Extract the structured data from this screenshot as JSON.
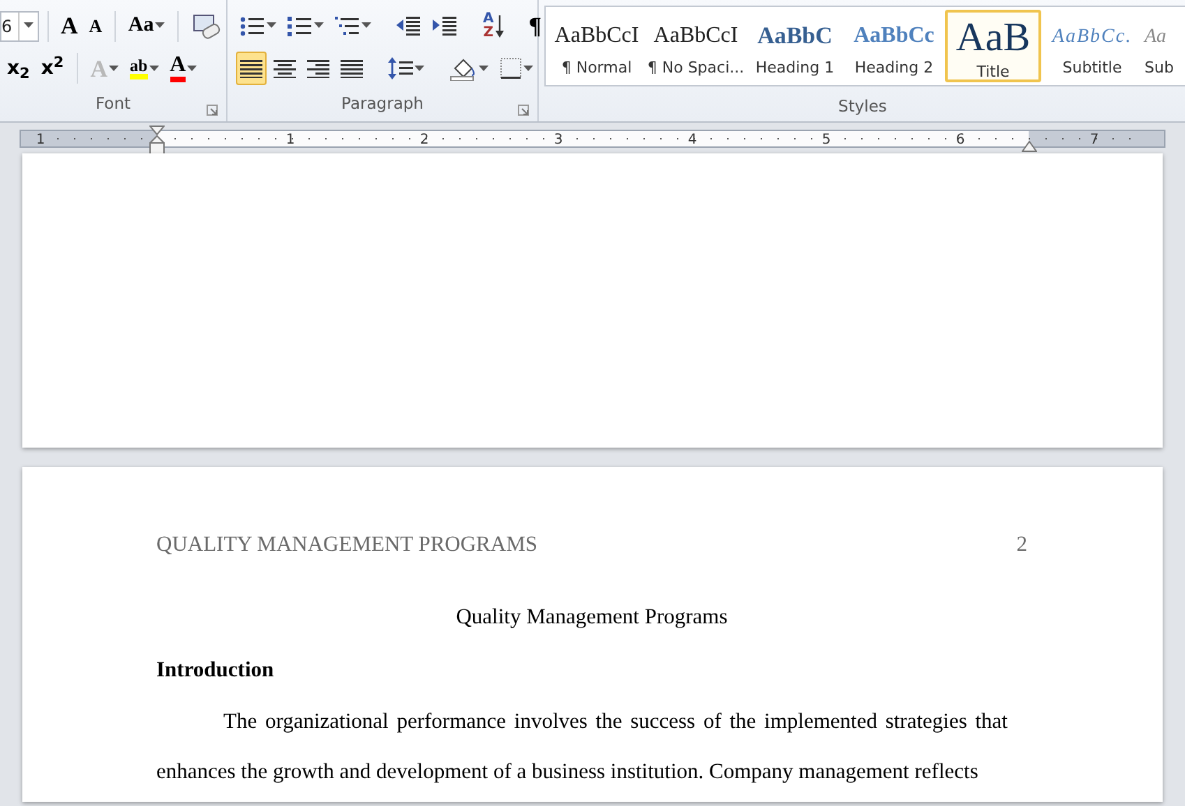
{
  "ribbon": {
    "font_group": {
      "font_size": "6",
      "label": "Font",
      "buttons_row_1": [
        {
          "kind": "grow",
          "glyph": "A"
        },
        {
          "kind": "shrink",
          "glyph": "A"
        },
        {
          "kind": "case",
          "glyph": "Aa"
        },
        {
          "kind": "clear"
        }
      ],
      "buttons_row_2": [
        {
          "kind": "subscript",
          "glyph": "x$_{2}$"
        },
        {
          "kind": "superscript",
          "glyph": "x$^{2}$"
        },
        {
          "kind": "effects",
          "glyph": "A",
          "disabled": true
        },
        {
          "kind": "highlight",
          "glyph": "ab",
          "color": "#ffff00"
        },
        {
          "kind": "fontcolor",
          "glyph": "A",
          "color": "#ff0000"
        }
      ]
    },
    "paragraph_group": {
      "label": "Paragraph",
      "buttons_row_1": [
        {
          "kind": "bullets"
        },
        {
          "kind": "numbering"
        },
        {
          "kind": "multilevel"
        },
        {
          "kind": "outdent"
        },
        {
          "kind": "indent"
        },
        {
          "kind": "sort",
          "glyph": "A",
          "glyph2": "Z"
        },
        {
          "kind": "pilcrow",
          "glyph": "¶"
        }
      ],
      "buttons_row_2": [
        {
          "kind": "align-left",
          "selected": true
        },
        {
          "kind": "align-center",
          "selected": false
        },
        {
          "kind": "align-right",
          "selected": false
        },
        {
          "kind": "justify",
          "selected": false
        },
        {
          "kind": "spacing"
        },
        {
          "kind": "shading"
        },
        {
          "kind": "borders"
        }
      ]
    },
    "styles_group": {
      "label": "Styles",
      "items": [
        {
          "kind": "normal",
          "preview": "AaBbCcI",
          "label": "¶ Normal",
          "selected": false
        },
        {
          "kind": "nospacing",
          "preview": "AaBbCcI",
          "label": "¶ No Spaci...",
          "selected": false
        },
        {
          "kind": "heading1",
          "preview": "AaBbC",
          "label": "Heading 1",
          "selected": false
        },
        {
          "kind": "heading2",
          "preview": "AaBbCc",
          "label": "Heading 2",
          "selected": false
        },
        {
          "kind": "title",
          "preview": "AaB",
          "label": "Title",
          "selected": true
        },
        {
          "kind": "subtitle",
          "preview": "AaBbCc.",
          "label": "Subtitle",
          "selected": false
        },
        {
          "kind": "subtle",
          "preview": "Aa",
          "label": "Sub",
          "selected": false
        }
      ]
    }
  },
  "ruler": {
    "labels": [
      "1",
      "1",
      "2",
      "3",
      "4",
      "5",
      "6",
      "7"
    ]
  },
  "document": {
    "page_2": {
      "header": "QUALITY MANAGEMENT PROGRAMS",
      "page_number": "2",
      "title": "Quality Management Programs",
      "heading": "Introduction",
      "paragraph": "The organizational performance involves the success of the implemented strategies that enhances the growth and development of a business institution. Company management reflects"
    }
  }
}
